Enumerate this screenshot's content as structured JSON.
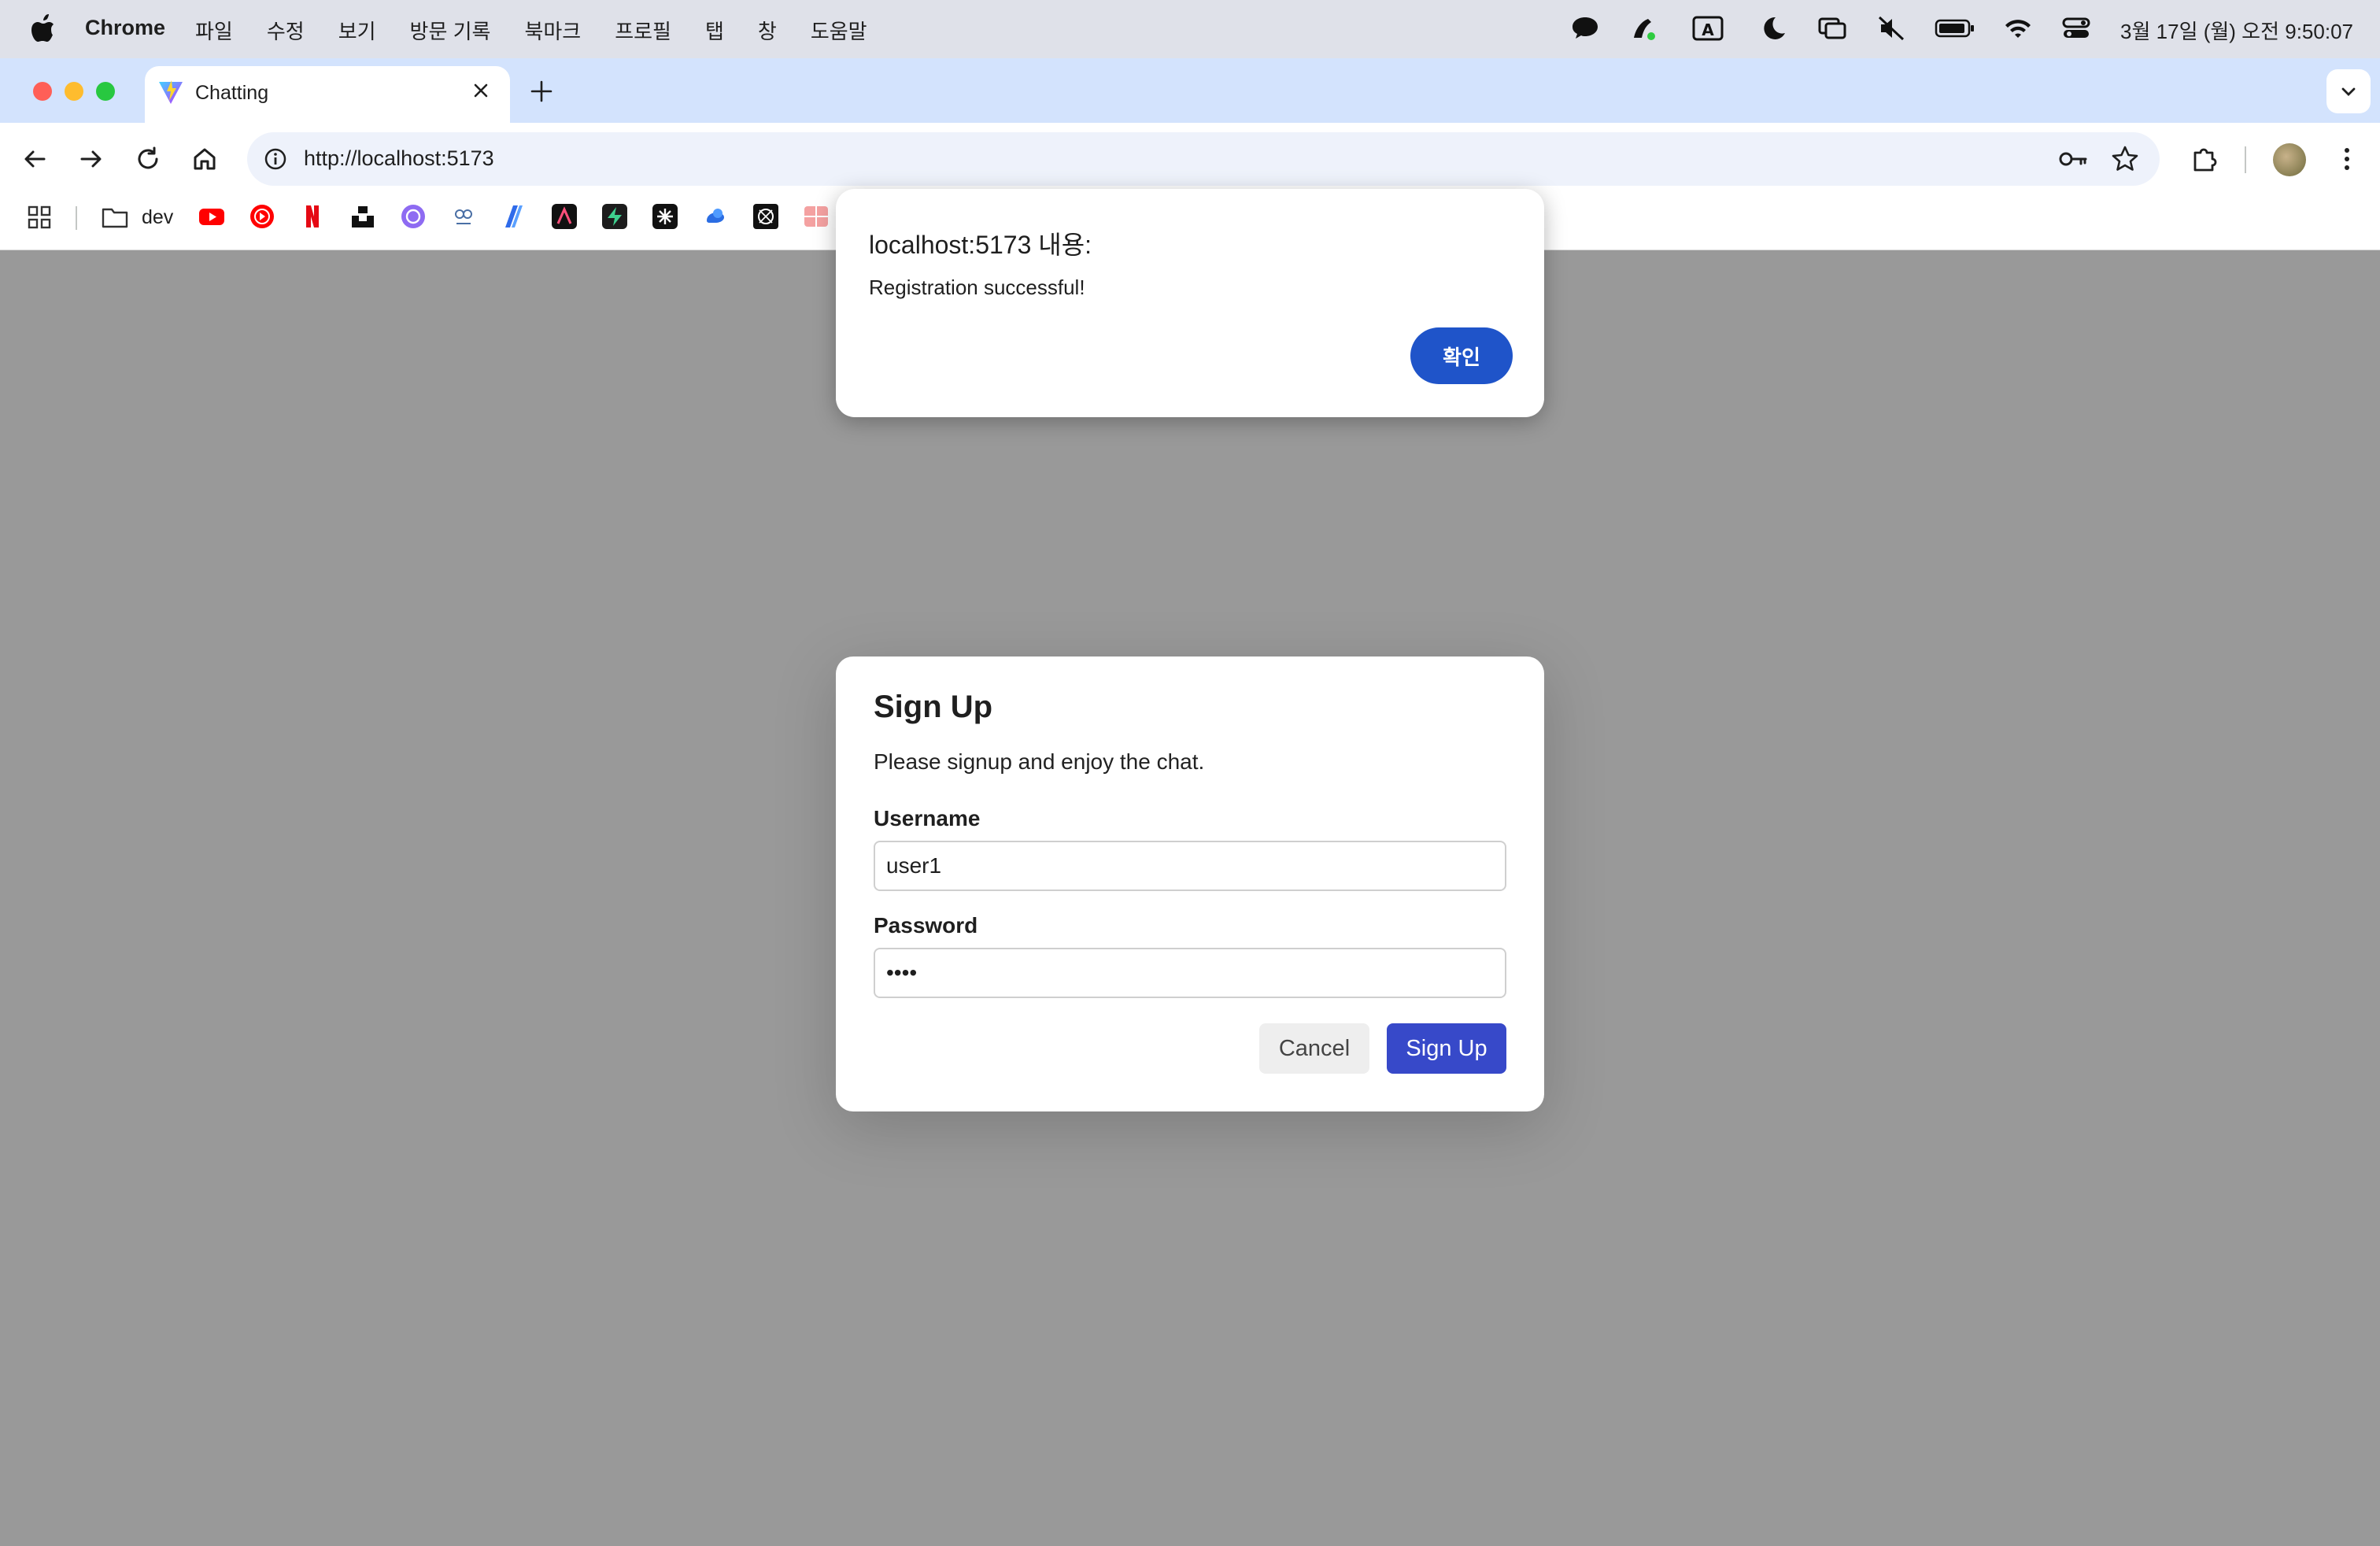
{
  "menubar": {
    "app_name": "Chrome",
    "menus": [
      "파일",
      "수정",
      "보기",
      "방문 기록",
      "북마크",
      "프로필",
      "탭",
      "창",
      "도움말"
    ],
    "clock": "3월 17일 (월) 오전 9:50:07",
    "status_icons": [
      "messages-icon",
      "pen-icon",
      "input-source-icon",
      "focus-moon-icon",
      "screen-mirroring-icon",
      "mute-icon",
      "battery-icon",
      "wifi-icon",
      "control-center-icon"
    ]
  },
  "tab": {
    "title": "Chatting",
    "favicon": "vite-icon"
  },
  "toolbar": {
    "url": "http://localhost:5173"
  },
  "bookmarks": {
    "folder_label": "dev",
    "items": [
      "youtube-icon",
      "youtube-music-icon",
      "netflix-icon",
      "unsplash-icon",
      "chatgpt-icon",
      "owl-icon",
      "copilot-icon",
      "arc-icon",
      "supabase-icon",
      "perplexity-icon",
      "gemini-icon",
      "claude-icon",
      "grid-icon"
    ]
  },
  "alert": {
    "title": "localhost:5173 내용:",
    "message": "Registration successful!",
    "ok_label": "확인"
  },
  "signup": {
    "title": "Sign Up",
    "description": "Please signup and enjoy the chat.",
    "username_label": "Username",
    "username_value": "user1",
    "password_label": "Password",
    "password_value": "1234",
    "cancel_label": "Cancel",
    "submit_label": "Sign Up"
  },
  "colors": {
    "primary_button": "#3749c9",
    "alert_button": "#1f54c9",
    "overlay": "#999999",
    "tabstrip": "#d3e3fd"
  }
}
